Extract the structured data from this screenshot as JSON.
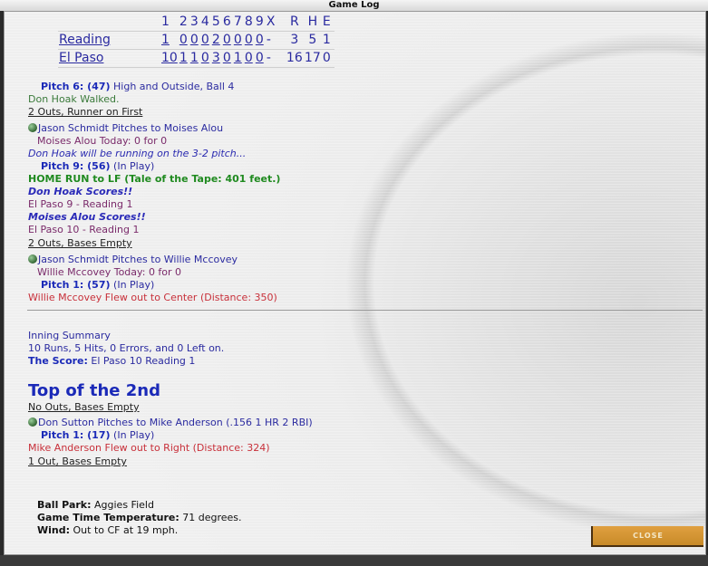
{
  "window": {
    "title": "Game Log"
  },
  "scoreboard": {
    "headers": [
      "1",
      "2",
      "3",
      "4",
      "5",
      "6",
      "7",
      "8",
      "9",
      "X",
      "R",
      "H",
      "E"
    ],
    "rows": [
      {
        "team": "Reading",
        "innings": [
          "1",
          "0",
          "0",
          "0",
          "2",
          "0",
          "0",
          "0",
          "0",
          "-"
        ],
        "r": "3",
        "h": "5",
        "e": "1"
      },
      {
        "team": "El Paso",
        "innings": [
          "10",
          "1",
          "1",
          "0",
          "3",
          "0",
          "1",
          "0",
          "0",
          "-"
        ],
        "r": "16",
        "h": "17",
        "e": "0"
      }
    ]
  },
  "log": [
    {
      "a": "Pitch 6: (47)",
      "b": " High and Outside, Ball 4"
    },
    {
      "a": "Don Hoak Walked."
    },
    {
      "a": "2 Outs, Runner on First"
    },
    {
      "a": "Jason Schmidt Pitches to Moises Alou"
    },
    {
      "a": "Moises Alou Today: 0 for 0"
    },
    {
      "a": "Don Hoak will be running on the 3-2 pitch..."
    },
    {
      "a": "Pitch 9: (56)",
      "b": "  (In Play)"
    },
    {
      "a": "HOME RUN to LF (Tale of the Tape: 401 feet.)"
    },
    {
      "a": "Don Hoak ",
      "b": "Scores!!"
    },
    {
      "a": "El Paso 9 - Reading 1"
    },
    {
      "a": "Moises Alou ",
      "b": "Scores!!"
    },
    {
      "a": "El Paso 10 - Reading 1"
    },
    {
      "a": "2 Outs, Bases Empty"
    },
    {
      "a": "Jason Schmidt Pitches to Willie Mccovey"
    },
    {
      "a": "Willie Mccovey Today: 0 for 0"
    },
    {
      "a": "Pitch 1: (57)",
      "b": "  (In Play)"
    },
    {
      "a": "Willie Mccovey Flew out to Center (Distance: 350)"
    }
  ],
  "summary": {
    "title": "Inning Summary",
    "line": "10 Runs, 5 Hits, 0 Errors, and 0 Left on.",
    "score_label": "The Score:",
    "score": " El Paso 10   Reading 1"
  },
  "inning2": {
    "heading": "Top of the 2nd",
    "lines": [
      {
        "a": "No Outs, Bases Empty"
      },
      {
        "a": "Don Sutton Pitches to Mike Anderson (.156 1 HR 2 RBI)"
      },
      {
        "a": "Pitch 1: (17)",
        "b": "  (In Play)"
      },
      {
        "a": "Mike Anderson Flew out to Right (Distance: 324)"
      },
      {
        "a": "1 Out, Bases Empty"
      }
    ]
  },
  "conditions": {
    "park_label": "Ball Park:",
    "park": " Aggies Field",
    "temp_label": "Game Time Temperature:",
    "temp": " 71 degrees.",
    "wind_label": "Wind:",
    "wind": " Out to CF at 19 mph."
  },
  "buttons": {
    "close": "CLOSE"
  },
  "colors": {
    "button": "#d69a38",
    "link": "#2a2aa0"
  }
}
